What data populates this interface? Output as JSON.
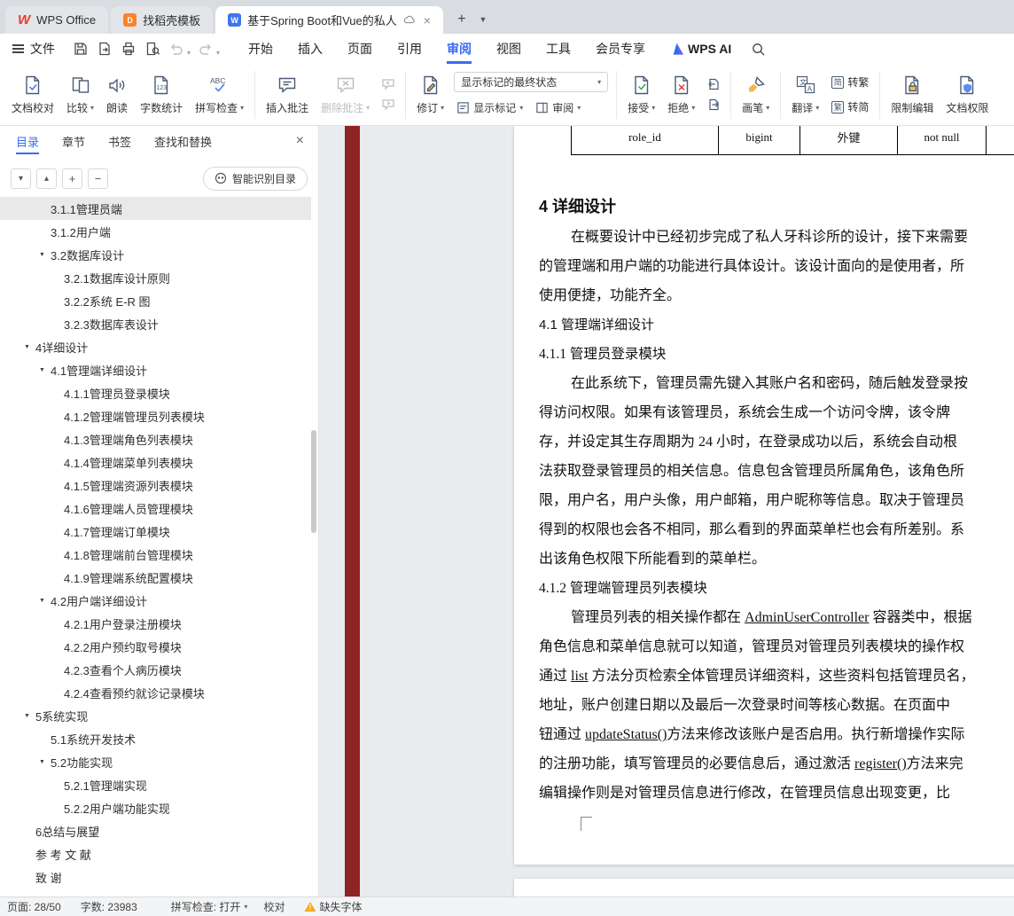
{
  "window_tabs": {
    "home": "WPS Office",
    "docer": "找稻壳模板",
    "doc": "基于Spring Boot和Vue的私人"
  },
  "menubar": {
    "file": "文件",
    "tabs": [
      "开始",
      "插入",
      "页面",
      "引用",
      "审阅",
      "视图",
      "工具",
      "会员专享"
    ],
    "active_tab": "审阅",
    "ai": "WPS AI"
  },
  "ribbon": {
    "doc_proof": "文档校对",
    "compare": "比较",
    "read_aloud": "朗读",
    "word_count": "字数统计",
    "spell_check": "拼写检查",
    "insert_comment": "插入批注",
    "delete_comment": "删除批注",
    "track_changes": "修订",
    "markup_state": "显示标记的最终状态",
    "show_markup": "显示标记",
    "review_pane": "审阅",
    "accept": "接受",
    "reject": "拒绝",
    "pen": "画笔",
    "translate": "翻译",
    "to_trad_icon": "简",
    "to_trad": "转繁",
    "to_simp_icon": "繁",
    "to_simp": "转简",
    "restrict_edit": "限制编辑",
    "doc_permission": "文档权限"
  },
  "sidebar": {
    "tabs": [
      "目录",
      "章节",
      "书签",
      "查找和替换"
    ],
    "active_tab": "目录",
    "smart_toc": "智能识别目录",
    "toc": [
      {
        "label": "3.1.1管理员端",
        "indent": 57,
        "selected": true
      },
      {
        "label": "3.1.2用户端",
        "indent": 57
      },
      {
        "label": "3.2数据库设计",
        "indent": 57,
        "tri": true
      },
      {
        "label": "3.2.1数据库设计原则",
        "indent": 72
      },
      {
        "label": "3.2.2系统 E-R 图",
        "indent": 72
      },
      {
        "label": "3.2.3数据库表设计",
        "indent": 72
      },
      {
        "label": "4详细设计",
        "indent": 40,
        "tri": true
      },
      {
        "label": "4.1管理端详细设计",
        "indent": 57,
        "tri": true
      },
      {
        "label": "4.1.1管理员登录模块",
        "indent": 72
      },
      {
        "label": "4.1.2管理端管理员列表模块",
        "indent": 72
      },
      {
        "label": "4.1.3管理端角色列表模块",
        "indent": 72
      },
      {
        "label": "4.1.4管理端菜单列表模块",
        "indent": 72
      },
      {
        "label": "4.1.5管理端资源列表模块",
        "indent": 72
      },
      {
        "label": "4.1.6管理端人员管理模块",
        "indent": 72
      },
      {
        "label": "4.1.7管理端订单模块",
        "indent": 72
      },
      {
        "label": "4.1.8管理端前台管理模块",
        "indent": 72
      },
      {
        "label": "4.1.9管理端系统配置模块",
        "indent": 72
      },
      {
        "label": "4.2用户端详细设计",
        "indent": 57,
        "tri": true
      },
      {
        "label": "4.2.1用户登录注册模块",
        "indent": 72
      },
      {
        "label": "4.2.2用户预约取号模块",
        "indent": 72
      },
      {
        "label": "4.2.3查看个人病历模块",
        "indent": 72
      },
      {
        "label": "4.2.4查看预约就诊记录模块",
        "indent": 72
      },
      {
        "label": "5系统实现",
        "indent": 40,
        "tri": true
      },
      {
        "label": "5.1系统开发技术",
        "indent": 57
      },
      {
        "label": "5.2功能实现",
        "indent": 57,
        "tri": true
      },
      {
        "label": "5.2.1管理端实现",
        "indent": 72
      },
      {
        "label": "5.2.2用户端功能实现",
        "indent": 72
      },
      {
        "label": "6总结与展望",
        "indent": 40
      },
      {
        "label": "参 考 文 献",
        "indent": 40
      },
      {
        "label": "致 谢",
        "indent": 40
      }
    ]
  },
  "document": {
    "table_row": [
      "role_id",
      "bigint",
      "外键",
      "not null",
      ""
    ],
    "blocks": [
      {
        "type": "h1",
        "text": "4 详细设计"
      },
      {
        "type": "p",
        "lines": [
          "在概要设计中已经初步完成了私人牙科诊所的设计，接下来需要",
          "的管理端和用户端的功能进行具体设计。该设计面向的是使用者，所",
          "使用便捷，功能齐全。"
        ]
      },
      {
        "type": "h2",
        "text": "4.1 管理端详细设计"
      },
      {
        "type": "h3",
        "text": "4.1.1 管理员登录模块"
      },
      {
        "type": "p",
        "lines": [
          "在此系统下，管理员需先键入其账户名和密码，随后触发登录按",
          "得访问权限。如果有该管理员，系统会生成一个访问令牌，该令牌",
          "存，并设定其生存周期为 24 小时，在登录成功以后，系统会自动根",
          "法获取登录管理员的相关信息。信息包含管理员所属角色，该角色所",
          "限，用户名，用户头像，用户邮箱，用户昵称等信息。取决于管理员",
          "得到的权限也会各不相同，那么看到的界面菜单栏也会有所差别。系",
          "出该角色权限下所能看到的菜单栏。"
        ]
      },
      {
        "type": "h3",
        "text": "4.1.2 管理端管理员列表模块"
      },
      {
        "type": "p",
        "lines": [
          [
            {
              "t": "管理员列表的相关操作都在 "
            },
            {
              "t": "AdminUserController",
              "u": true
            },
            {
              "t": " 容器类中，根据"
            }
          ],
          "角色信息和菜单信息就可以知道，管理员对管理员列表模块的操作权",
          [
            {
              "t": "通过 "
            },
            {
              "t": "list",
              "u": true
            },
            {
              "t": " 方法分页检索全体管理员详细资料，这些资料包括管理员名，"
            }
          ],
          "地址，账户创建日期以及最后一次登录时间等核心数据。在页面中",
          [
            {
              "t": "钮通过 "
            },
            {
              "t": "updateStatus()",
              "u": true
            },
            {
              "t": "方法来修改该账户是否启用。执行新增操作实际"
            }
          ],
          [
            {
              "t": "的注册功能，填写管理员的必要信息后，通过激活 "
            },
            {
              "t": "register()",
              "u": true
            },
            {
              "t": "方法来完"
            }
          ],
          "编辑操作则是对管理员信息进行修改，在管理员信息出现变更，比"
        ]
      }
    ]
  },
  "statusbar": {
    "page": "页面: 28/50",
    "words": "字数: 23983",
    "spell": "拼写检查: 打开",
    "proof": "校对",
    "missing_font": "缺失字体"
  },
  "colors": {
    "accent": "#3c6bf0",
    "red_strip": "#8e2525",
    "warning": "#f7a825"
  }
}
